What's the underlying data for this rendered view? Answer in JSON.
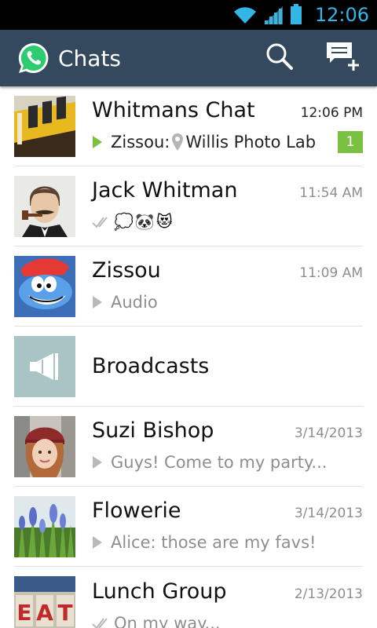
{
  "status_bar": {
    "time": "12:06",
    "icons": [
      "wifi-icon",
      "signal-icon",
      "battery-icon"
    ],
    "accent_color": "#33b5e5"
  },
  "app_bar": {
    "title": "Chats",
    "background": "#34495e",
    "actions": [
      "search-icon",
      "new-chat-icon"
    ]
  },
  "chats": [
    {
      "name": "Whitmans Chat",
      "time": "12:06 PM",
      "sender": "Zissou:",
      "preview": "Willis Photo Lab",
      "unread_count": "1",
      "avatar": "boat-photo"
    },
    {
      "name": "Jack Whitman",
      "time": "11:54 AM",
      "emojis": [
        "💭",
        "🐼",
        "😻"
      ],
      "avatar": "man-with-pipe-photo"
    },
    {
      "name": "Zissou",
      "time": "11:09 AM",
      "preview": "Audio",
      "avatar": "smurf-photo"
    },
    {
      "name": "Broadcasts",
      "avatar": "megaphone-icon"
    },
    {
      "name": "Suzi Bishop",
      "time": "3/14/2013",
      "preview": "Guys! Come to my party...",
      "avatar": "woman-beanie-photo"
    },
    {
      "name": "Flowerie",
      "time": "3/14/2013",
      "preview": "Alice: those are my favs!",
      "avatar": "flowers-photo"
    },
    {
      "name": "Lunch Group",
      "time": "2/13/2013",
      "preview": "On my way...",
      "avatar": "eat-sign-photo"
    }
  ],
  "colors": {
    "badge": "#7ac142",
    "play_unread": "#7ac142",
    "muted_text": "#8e8e8e",
    "broadcast_avatar": "#a9c4c4"
  }
}
